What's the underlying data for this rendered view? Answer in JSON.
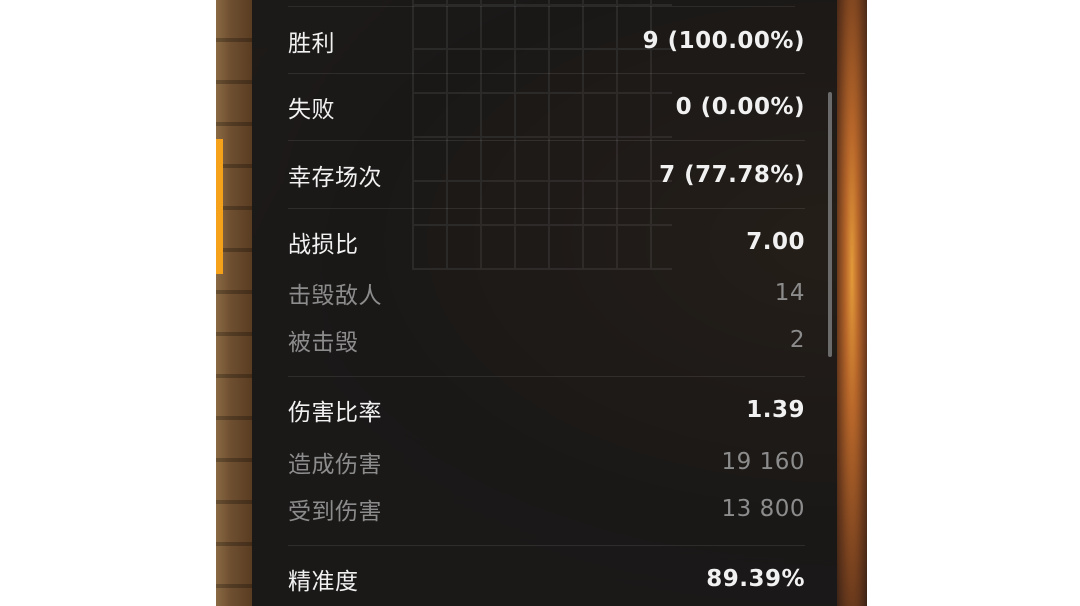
{
  "stats": [
    {
      "label": "胜利",
      "value": "9 (100.00%)",
      "kind": "primary"
    },
    {
      "label": "失败",
      "value": "0 (0.00%)",
      "kind": "primary"
    },
    {
      "label": "幸存场次",
      "value": "7 (77.78%)",
      "kind": "primary"
    },
    {
      "label": "战损比",
      "value": "7.00",
      "kind": "primary"
    },
    {
      "label": "击毁敌人",
      "value": "14",
      "kind": "secondary"
    },
    {
      "label": "被击毁",
      "value": "2",
      "kind": "secondary"
    },
    {
      "label": "伤害比率",
      "value": "1.39",
      "kind": "primary"
    },
    {
      "label": "造成伤害",
      "value": "19 160",
      "kind": "secondary"
    },
    {
      "label": "受到伤害",
      "value": "13 800",
      "kind": "secondary"
    },
    {
      "label": "精准度",
      "value": "89.39%",
      "kind": "primary"
    }
  ],
  "colors": {
    "accent": "#f5a21a",
    "primary_text": "#f1f1f1",
    "secondary_text": "#8c8c8c",
    "panel_bg": "#181818"
  }
}
